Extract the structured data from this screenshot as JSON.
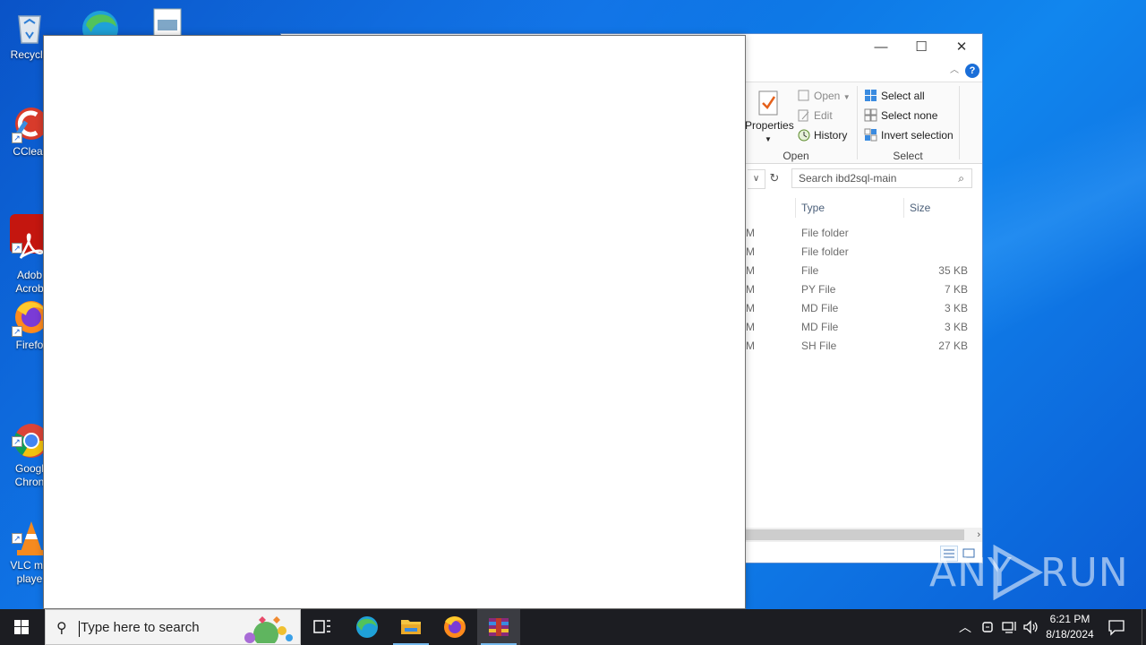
{
  "desktop": {
    "icons": [
      {
        "name": "recycle-bin",
        "label": "Recycle"
      },
      {
        "name": "ccleaner",
        "label": "CClear"
      },
      {
        "name": "adobe-acrobat",
        "label": "Adob\nAcrob"
      },
      {
        "name": "firefox",
        "label": "Firefo"
      },
      {
        "name": "google-chrome",
        "label": "Googl\nChron"
      },
      {
        "name": "vlc",
        "label": "VLC me\nplaye"
      }
    ]
  },
  "explorer": {
    "ribbon": {
      "properties_label": "Properties",
      "open_label": "Open",
      "edit_label": "Edit",
      "history_label": "History",
      "open_group": "Open",
      "select_all": "Select all",
      "select_none": "Select none",
      "invert_selection": "Invert selection",
      "select_group": "Select"
    },
    "search_placeholder": "Search ibd2sql-main",
    "columns": {
      "type": "Type",
      "size": "Size"
    },
    "rows": [
      {
        "mod": "M",
        "type": "File folder",
        "size": ""
      },
      {
        "mod": "M",
        "type": "File folder",
        "size": ""
      },
      {
        "mod": "M",
        "type": "File",
        "size": "35 KB"
      },
      {
        "mod": "M",
        "type": "PY File",
        "size": "7 KB"
      },
      {
        "mod": "M",
        "type": "MD File",
        "size": "3 KB"
      },
      {
        "mod": "M",
        "type": "MD File",
        "size": "3 KB"
      },
      {
        "mod": "M",
        "type": "SH File",
        "size": "27 KB"
      }
    ]
  },
  "watermark": {
    "left": "ANY",
    "right": "RUN"
  },
  "taskbar": {
    "search_placeholder": "Type here to search",
    "time": "6:21 PM",
    "date": "8/18/2024"
  },
  "colors": {
    "accent": "#0a5bd4",
    "taskbar": "#1c1d22"
  }
}
